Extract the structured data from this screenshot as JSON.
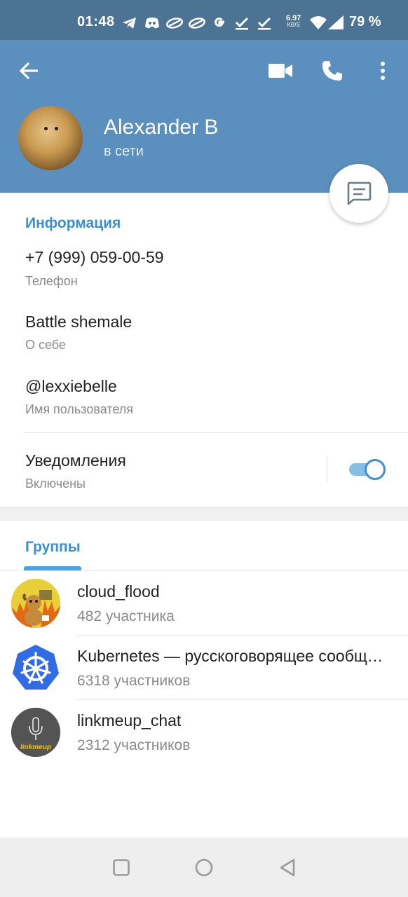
{
  "status_bar": {
    "time": "01:48",
    "speed_value": "6.97",
    "speed_unit": "KB/S",
    "battery": "79 %",
    "notification_icons": [
      "telegram-icon",
      "discord-icon",
      "cloud-icon",
      "cloud-icon",
      "google-icon",
      "check-icon",
      "check-icon"
    ]
  },
  "header": {
    "name": "Alexander B",
    "status": "в сети"
  },
  "info": {
    "section_title": "Информация",
    "phone": "+7 (999) 059-00-59",
    "phone_label": "Телефон",
    "bio": "Battle shemale",
    "bio_label": "О себе",
    "username": "@lexxiebelle",
    "username_label": "Имя пользователя",
    "notifications": "Уведомления",
    "notifications_state": "Включены",
    "notifications_enabled": true
  },
  "groups": {
    "tab_label": "Группы",
    "items": [
      {
        "name": "cloud_flood",
        "members": "482 участника",
        "avatar_icon": "dog-fire-icon"
      },
      {
        "name": "Kubernetes — русскоговорящее сообщество",
        "members": "6318 участников",
        "avatar_icon": "kubernetes-wheel-icon"
      },
      {
        "name": "linkmeup_chat",
        "members": "2312 участников",
        "avatar_icon": "linkmeup-logo-icon",
        "logo_text": "linkmeup"
      }
    ]
  },
  "colors": {
    "header_bg": "#5b8fbd",
    "status_bar_bg": "#4d7394",
    "accent": "#3e8fcf",
    "kubernetes_blue": "#326ce5"
  }
}
